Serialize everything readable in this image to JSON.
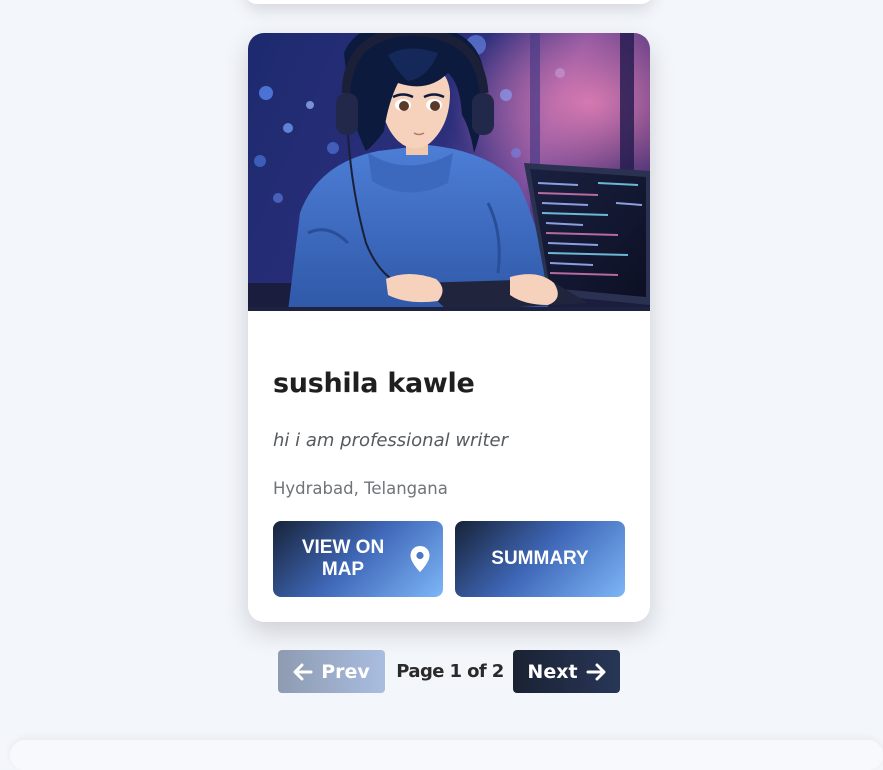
{
  "profile_card": {
    "name": "sushila kawle",
    "bio": "hi i am professional writer",
    "location": "Hydrabad, Telangana",
    "image_icon": "anime-coder-illustration",
    "buttons": {
      "view_on_map": "VIEW ON MAP",
      "view_on_map_icon": "map-pin-icon",
      "summary": "SUMMARY"
    }
  },
  "pagination": {
    "prev_label": "Prev",
    "prev_icon": "arrow-left-icon",
    "status": "Page 1 of 2",
    "next_label": "Next",
    "next_icon": "arrow-right-icon",
    "current_page": 1,
    "total_pages": 2
  },
  "colors": {
    "page_background": "#f3f6fb",
    "button_gradient_start": "#172338",
    "button_gradient_mid": "#3f67b7",
    "button_gradient_end": "#7db6f7",
    "next_button": "#1a2233",
    "prev_button_disabled": "#8e9bb1"
  }
}
